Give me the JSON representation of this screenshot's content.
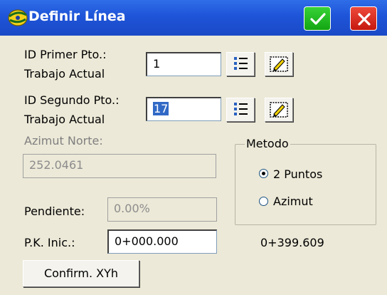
{
  "window": {
    "title": "Definir Línea"
  },
  "first_point": {
    "label_line1": "ID Primer Pto.:",
    "label_line2": "Trabajo Actual",
    "value": "1"
  },
  "second_point": {
    "label_line1": "ID Segundo Pto.:",
    "label_line2": "Trabajo Actual",
    "value": "17"
  },
  "azimuth": {
    "label": "Azimut Norte:",
    "value": "252.0461"
  },
  "method": {
    "title": "Metodo",
    "options": [
      {
        "label": "2 Puntos",
        "selected": true
      },
      {
        "label": "Azimut",
        "selected": false
      }
    ]
  },
  "slope": {
    "label": "Pendiente:",
    "value": "0.00%"
  },
  "start_station": {
    "label": "P.K. Inic.:",
    "value": "0+000.000",
    "end_value": "0+399.609"
  },
  "confirm_button": {
    "label": "Confirm. XYh"
  },
  "icons": [
    "app-logo-icon",
    "checkmark-icon",
    "close-icon",
    "point-list-icon",
    "map-pick-icon"
  ],
  "colors": {
    "titlebar": "#1e54d8",
    "ok": "#22b522",
    "close": "#d9241a",
    "selection": "#3169c6"
  }
}
